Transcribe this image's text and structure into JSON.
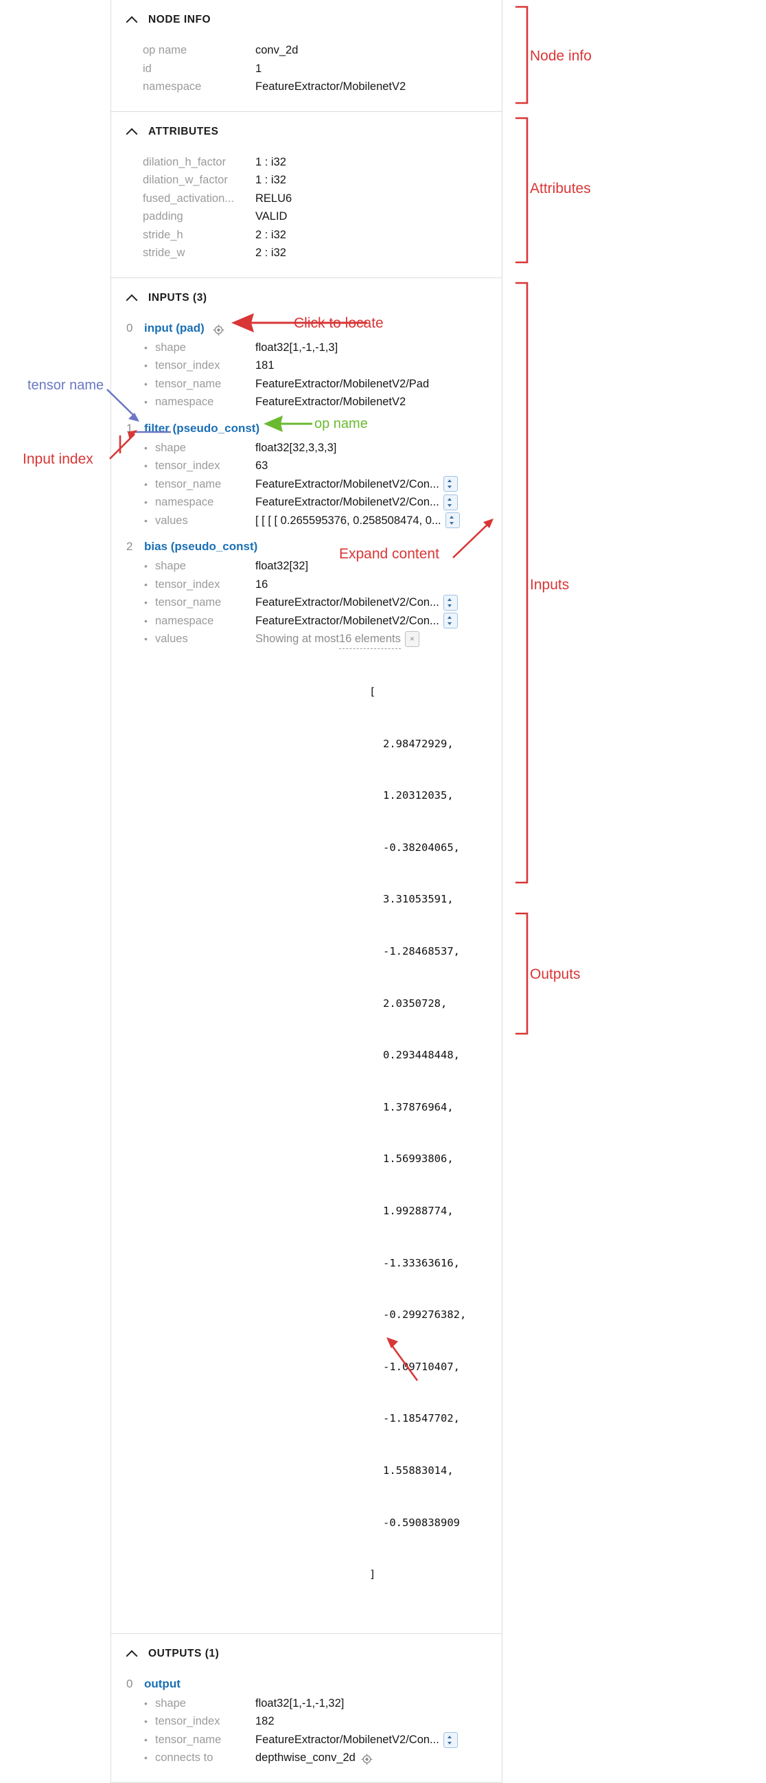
{
  "sections": {
    "node_info": {
      "title": "NODE INFO",
      "rows": [
        {
          "key": "op name",
          "value": "conv_2d"
        },
        {
          "key": "id",
          "value": "1"
        },
        {
          "key": "namespace",
          "value": "FeatureExtractor/MobilenetV2"
        }
      ]
    },
    "attributes": {
      "title": "ATTRIBUTES",
      "rows": [
        {
          "key": "dilation_h_factor",
          "value": "1 : i32"
        },
        {
          "key": "dilation_w_factor",
          "value": "1 : i32"
        },
        {
          "key": "fused_activation...",
          "value": "RELU6"
        },
        {
          "key": "padding",
          "value": "VALID"
        },
        {
          "key": "stride_h",
          "value": "2 : i32"
        },
        {
          "key": "stride_w",
          "value": "2 : i32"
        }
      ]
    },
    "inputs": {
      "title": "INPUTS (3)",
      "items": [
        {
          "index": "0",
          "name": "input (pad)",
          "has_locate": true,
          "rows": [
            {
              "key": "shape",
              "value": "float32[1,-1,-1,3]",
              "stepper": false
            },
            {
              "key": "tensor_index",
              "value": "181",
              "stepper": false
            },
            {
              "key": "tensor_name",
              "value": "FeatureExtractor/MobilenetV2/Pad",
              "stepper": false
            },
            {
              "key": "namespace",
              "value": "FeatureExtractor/MobilenetV2",
              "stepper": false
            }
          ]
        },
        {
          "index": "1",
          "name": "filter (pseudo_const)",
          "has_locate": false,
          "rows": [
            {
              "key": "shape",
              "value": "float32[32,3,3,3]",
              "stepper": false
            },
            {
              "key": "tensor_index",
              "value": "63",
              "stepper": false
            },
            {
              "key": "tensor_name",
              "value": "FeatureExtractor/MobilenetV2/Con...",
              "stepper": true
            },
            {
              "key": "namespace",
              "value": "FeatureExtractor/MobilenetV2/Con...",
              "stepper": true
            },
            {
              "key": "values",
              "value": "[ [ [ [ 0.265595376, 0.258508474, 0...",
              "stepper": true
            }
          ]
        },
        {
          "index": "2",
          "name": "bias (pseudo_const)",
          "has_locate": false,
          "rows": [
            {
              "key": "shape",
              "value": "float32[32]",
              "stepper": false
            },
            {
              "key": "tensor_index",
              "value": "16",
              "stepper": false
            },
            {
              "key": "tensor_name",
              "value": "FeatureExtractor/MobilenetV2/Con...",
              "stepper": true
            },
            {
              "key": "namespace",
              "value": "FeatureExtractor/MobilenetV2/Con...",
              "stepper": true
            }
          ],
          "values_row": {
            "key": "values",
            "prefix": "Showing at most ",
            "link": "16 elements",
            "close_box": "×"
          },
          "values_list": [
            "2.98472929",
            "1.20312035",
            "-0.38204065",
            "3.31053591",
            "-1.28468537",
            "2.0350728",
            "0.293448448",
            "1.37876964",
            "1.56993806",
            "1.99288774",
            "-1.33363616",
            "-0.299276382",
            "-1.09710407",
            "-1.18547702",
            "1.55883014",
            "-0.590838909"
          ]
        }
      ]
    },
    "outputs": {
      "title": "OUTPUTS (1)",
      "items": [
        {
          "index": "0",
          "name": "output",
          "has_locate": false,
          "rows": [
            {
              "key": "shape",
              "value": "float32[1,-1,-1,32]",
              "stepper": false
            },
            {
              "key": "tensor_index",
              "value": "182",
              "stepper": false
            },
            {
              "key": "tensor_name",
              "value": "FeatureExtractor/MobilenetV2/Con...",
              "stepper": true
            },
            {
              "key": "connects to",
              "value": "depthwise_conv_2d",
              "stepper": false,
              "locate": true
            }
          ]
        }
      ]
    }
  },
  "annotations": {
    "node_info_label": "Node info",
    "attributes_label": "Attributes",
    "inputs_label": "Inputs",
    "outputs_label": "Outputs",
    "click_to_locate": "Click to locate",
    "op_name": "op name",
    "tensor_name": "tensor name",
    "input_index": "Input index",
    "expand_content": "Expand content"
  },
  "colors": {
    "annotation_red": "#d93636",
    "annotation_green": "#6aba2f",
    "annotation_blue": "#6b77c4",
    "link_blue": "#1a6fb5",
    "key_gray": "#9b9b9b"
  }
}
